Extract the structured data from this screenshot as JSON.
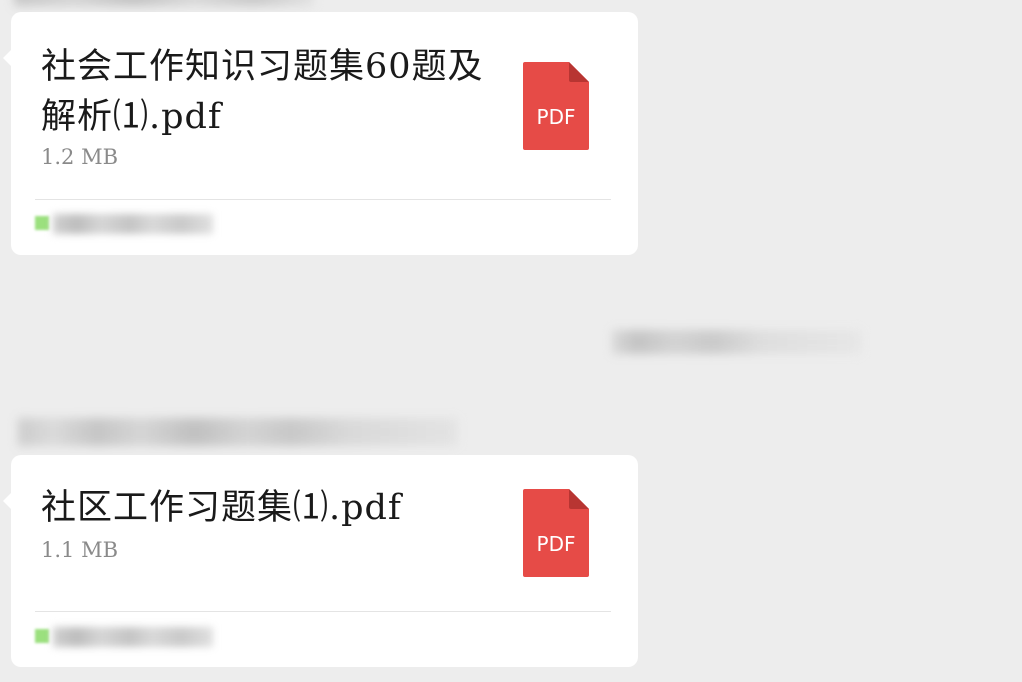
{
  "messages": [
    {
      "file_name": "社会工作知识习题集60题及解析⑴.pdf",
      "file_size": "1.2 MB",
      "icon_label": "PDF"
    },
    {
      "file_name": "社区工作习题集⑴.pdf",
      "file_size": "1.1 MB",
      "icon_label": "PDF"
    }
  ],
  "colors": {
    "background": "#ededed",
    "bubble": "#ffffff",
    "pdf_icon": "#e64b47",
    "source_icon": "#9be07e"
  }
}
